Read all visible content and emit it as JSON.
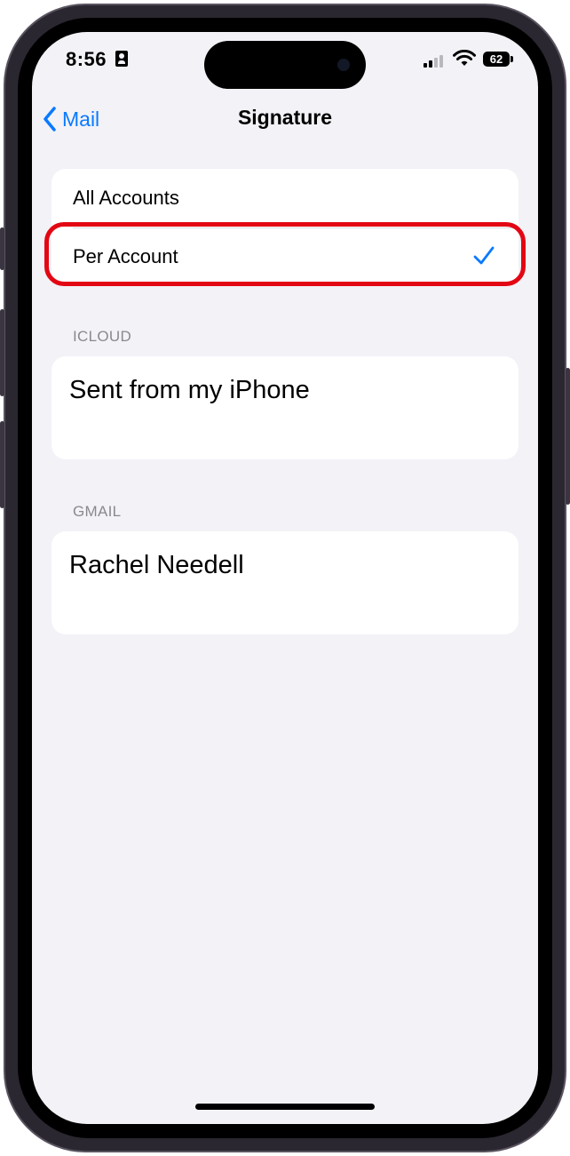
{
  "status_bar": {
    "time": "8:56",
    "battery": "62"
  },
  "nav": {
    "back_label": "Mail",
    "title": "Signature"
  },
  "options": [
    {
      "label": "All Accounts",
      "selected": false
    },
    {
      "label": "Per Account",
      "selected": true
    }
  ],
  "sections": [
    {
      "header": "ICLOUD",
      "signature": "Sent from my iPhone"
    },
    {
      "header": "GMAIL",
      "signature": "Rachel Needell"
    }
  ],
  "colors": {
    "accent": "#0a7aff",
    "highlight": "#e30613",
    "background": "#f2f2f7"
  }
}
